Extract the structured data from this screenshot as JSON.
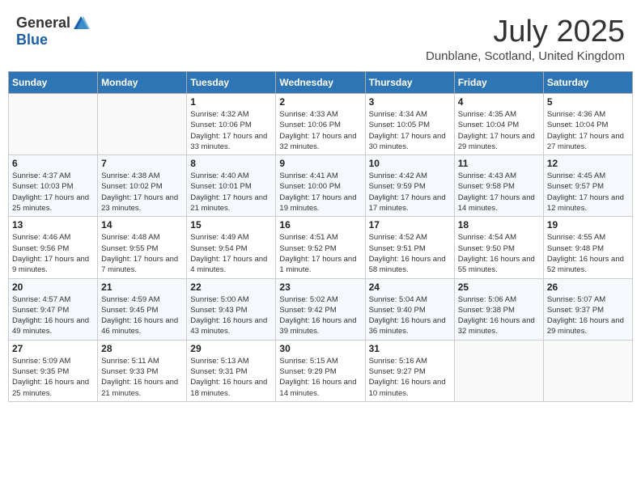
{
  "logo": {
    "general": "General",
    "blue": "Blue"
  },
  "header": {
    "month": "July 2025",
    "location": "Dunblane, Scotland, United Kingdom"
  },
  "weekdays": [
    "Sunday",
    "Monday",
    "Tuesday",
    "Wednesday",
    "Thursday",
    "Friday",
    "Saturday"
  ],
  "weeks": [
    [
      {
        "day": "",
        "info": ""
      },
      {
        "day": "",
        "info": ""
      },
      {
        "day": "1",
        "info": "Sunrise: 4:32 AM\nSunset: 10:06 PM\nDaylight: 17 hours and 33 minutes."
      },
      {
        "day": "2",
        "info": "Sunrise: 4:33 AM\nSunset: 10:06 PM\nDaylight: 17 hours and 32 minutes."
      },
      {
        "day": "3",
        "info": "Sunrise: 4:34 AM\nSunset: 10:05 PM\nDaylight: 17 hours and 30 minutes."
      },
      {
        "day": "4",
        "info": "Sunrise: 4:35 AM\nSunset: 10:04 PM\nDaylight: 17 hours and 29 minutes."
      },
      {
        "day": "5",
        "info": "Sunrise: 4:36 AM\nSunset: 10:04 PM\nDaylight: 17 hours and 27 minutes."
      }
    ],
    [
      {
        "day": "6",
        "info": "Sunrise: 4:37 AM\nSunset: 10:03 PM\nDaylight: 17 hours and 25 minutes."
      },
      {
        "day": "7",
        "info": "Sunrise: 4:38 AM\nSunset: 10:02 PM\nDaylight: 17 hours and 23 minutes."
      },
      {
        "day": "8",
        "info": "Sunrise: 4:40 AM\nSunset: 10:01 PM\nDaylight: 17 hours and 21 minutes."
      },
      {
        "day": "9",
        "info": "Sunrise: 4:41 AM\nSunset: 10:00 PM\nDaylight: 17 hours and 19 minutes."
      },
      {
        "day": "10",
        "info": "Sunrise: 4:42 AM\nSunset: 9:59 PM\nDaylight: 17 hours and 17 minutes."
      },
      {
        "day": "11",
        "info": "Sunrise: 4:43 AM\nSunset: 9:58 PM\nDaylight: 17 hours and 14 minutes."
      },
      {
        "day": "12",
        "info": "Sunrise: 4:45 AM\nSunset: 9:57 PM\nDaylight: 17 hours and 12 minutes."
      }
    ],
    [
      {
        "day": "13",
        "info": "Sunrise: 4:46 AM\nSunset: 9:56 PM\nDaylight: 17 hours and 9 minutes."
      },
      {
        "day": "14",
        "info": "Sunrise: 4:48 AM\nSunset: 9:55 PM\nDaylight: 17 hours and 7 minutes."
      },
      {
        "day": "15",
        "info": "Sunrise: 4:49 AM\nSunset: 9:54 PM\nDaylight: 17 hours and 4 minutes."
      },
      {
        "day": "16",
        "info": "Sunrise: 4:51 AM\nSunset: 9:52 PM\nDaylight: 17 hours and 1 minute."
      },
      {
        "day": "17",
        "info": "Sunrise: 4:52 AM\nSunset: 9:51 PM\nDaylight: 16 hours and 58 minutes."
      },
      {
        "day": "18",
        "info": "Sunrise: 4:54 AM\nSunset: 9:50 PM\nDaylight: 16 hours and 55 minutes."
      },
      {
        "day": "19",
        "info": "Sunrise: 4:55 AM\nSunset: 9:48 PM\nDaylight: 16 hours and 52 minutes."
      }
    ],
    [
      {
        "day": "20",
        "info": "Sunrise: 4:57 AM\nSunset: 9:47 PM\nDaylight: 16 hours and 49 minutes."
      },
      {
        "day": "21",
        "info": "Sunrise: 4:59 AM\nSunset: 9:45 PM\nDaylight: 16 hours and 46 minutes."
      },
      {
        "day": "22",
        "info": "Sunrise: 5:00 AM\nSunset: 9:43 PM\nDaylight: 16 hours and 43 minutes."
      },
      {
        "day": "23",
        "info": "Sunrise: 5:02 AM\nSunset: 9:42 PM\nDaylight: 16 hours and 39 minutes."
      },
      {
        "day": "24",
        "info": "Sunrise: 5:04 AM\nSunset: 9:40 PM\nDaylight: 16 hours and 36 minutes."
      },
      {
        "day": "25",
        "info": "Sunrise: 5:06 AM\nSunset: 9:38 PM\nDaylight: 16 hours and 32 minutes."
      },
      {
        "day": "26",
        "info": "Sunrise: 5:07 AM\nSunset: 9:37 PM\nDaylight: 16 hours and 29 minutes."
      }
    ],
    [
      {
        "day": "27",
        "info": "Sunrise: 5:09 AM\nSunset: 9:35 PM\nDaylight: 16 hours and 25 minutes."
      },
      {
        "day": "28",
        "info": "Sunrise: 5:11 AM\nSunset: 9:33 PM\nDaylight: 16 hours and 21 minutes."
      },
      {
        "day": "29",
        "info": "Sunrise: 5:13 AM\nSunset: 9:31 PM\nDaylight: 16 hours and 18 minutes."
      },
      {
        "day": "30",
        "info": "Sunrise: 5:15 AM\nSunset: 9:29 PM\nDaylight: 16 hours and 14 minutes."
      },
      {
        "day": "31",
        "info": "Sunrise: 5:16 AM\nSunset: 9:27 PM\nDaylight: 16 hours and 10 minutes."
      },
      {
        "day": "",
        "info": ""
      },
      {
        "day": "",
        "info": ""
      }
    ]
  ]
}
